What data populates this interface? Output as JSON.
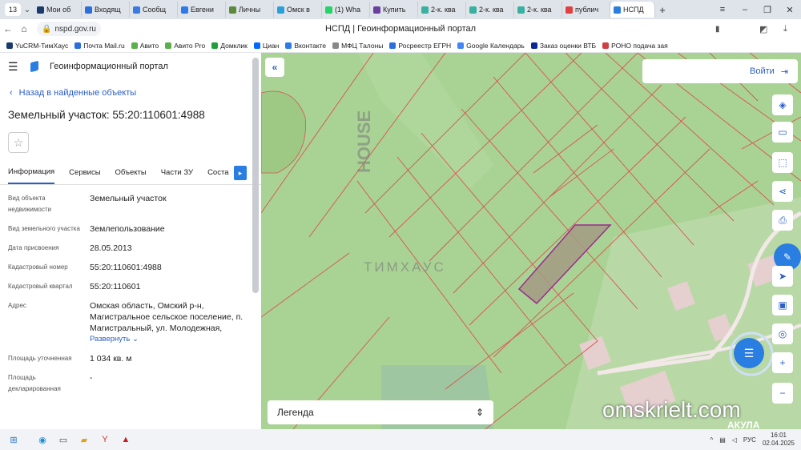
{
  "browser": {
    "tab_count": "13",
    "tabs": [
      {
        "label": "Мои об",
        "color": "#1b3a6b"
      },
      {
        "label": "Входящ",
        "color": "#2a6fdb"
      },
      {
        "label": "Сообщ",
        "color": "#3a7be0"
      },
      {
        "label": "Евгени",
        "color": "#2e7be8"
      },
      {
        "label": "Личны",
        "color": "#5a8a3a"
      },
      {
        "label": "Омск в",
        "color": "#2aa0d8"
      },
      {
        "label": "(1) Wha",
        "color": "#25d366"
      },
      {
        "label": "Купить",
        "color": "#6b3fa0"
      },
      {
        "label": "2-к. ква",
        "color": "#3ab0a0"
      },
      {
        "label": "2-к. ква",
        "color": "#3ab0a0"
      },
      {
        "label": "2-к. ква",
        "color": "#3ab0a0"
      },
      {
        "label": "публич",
        "color": "#e04040"
      },
      {
        "label": "НСПД",
        "color": "#2a7de1"
      }
    ],
    "url": "nspd.gov.ru",
    "page_title": "НСПД | Геоинформационный портал",
    "bookmarks": [
      {
        "label": "YuCRM-ТимХаус",
        "color": "#1b3a6b"
      },
      {
        "label": "Почта Mail.ru",
        "color": "#2a6fdb"
      },
      {
        "label": "Авито",
        "color": "#5ab04a"
      },
      {
        "label": "Авито Pro",
        "color": "#5ab04a"
      },
      {
        "label": "Домклик",
        "color": "#21a038"
      },
      {
        "label": "Циан",
        "color": "#0468ff"
      },
      {
        "label": "Вконтакте",
        "color": "#2e7be8"
      },
      {
        "label": "МФЦ Талоны",
        "color": "#888888"
      },
      {
        "label": "Росреестр ЕГРН",
        "color": "#2a6fdb"
      },
      {
        "label": "Google Календарь",
        "color": "#4285f4"
      },
      {
        "label": "Заказ оценки ВТБ",
        "color": "#0a2896"
      },
      {
        "label": "РОНО подача зая",
        "color": "#d04040"
      }
    ]
  },
  "portal": {
    "title": "Геоинформационный портал",
    "back": "Назад в найденные объекты"
  },
  "object": {
    "title": "Земельный участок: 55:20:110601:4988",
    "tabs": [
      "Информация",
      "Сервисы",
      "Объекты",
      "Части ЗУ",
      "Соста"
    ],
    "fields": [
      {
        "label": "Вид объекта недвижимости",
        "value": "Земельный участок"
      },
      {
        "label": "Вид земельного участка",
        "value": "Землепользование"
      },
      {
        "label": "Дата присвоения",
        "value": "28.05.2013"
      },
      {
        "label": "Кадастровый номер",
        "value": "55:20:110601:4988"
      },
      {
        "label": "Кадастровый квартал",
        "value": "55:20:110601"
      },
      {
        "label": "Адрес",
        "value": "Омская область, Омский р-н, Магистральное сельское поселение, п. Магистральный, ул. Молодежная,"
      },
      {
        "label": "Площадь уточненная",
        "value": "1 034 кв. м"
      },
      {
        "label": "Площадь декларированная",
        "value": "-"
      }
    ],
    "expand": "Развернуть"
  },
  "map": {
    "login": "Войти",
    "legend": "Легенда",
    "parcel_color": "#9b2a8f"
  },
  "watermark": {
    "brand_top": "HOUSE",
    "brand_bottom": "ТИМХАУС",
    "site": "omskrielt.com",
    "corner": "АКУЛА"
  },
  "taskbar": {
    "lang": "РУС",
    "time": "16:01",
    "date": "02.04.2025"
  }
}
